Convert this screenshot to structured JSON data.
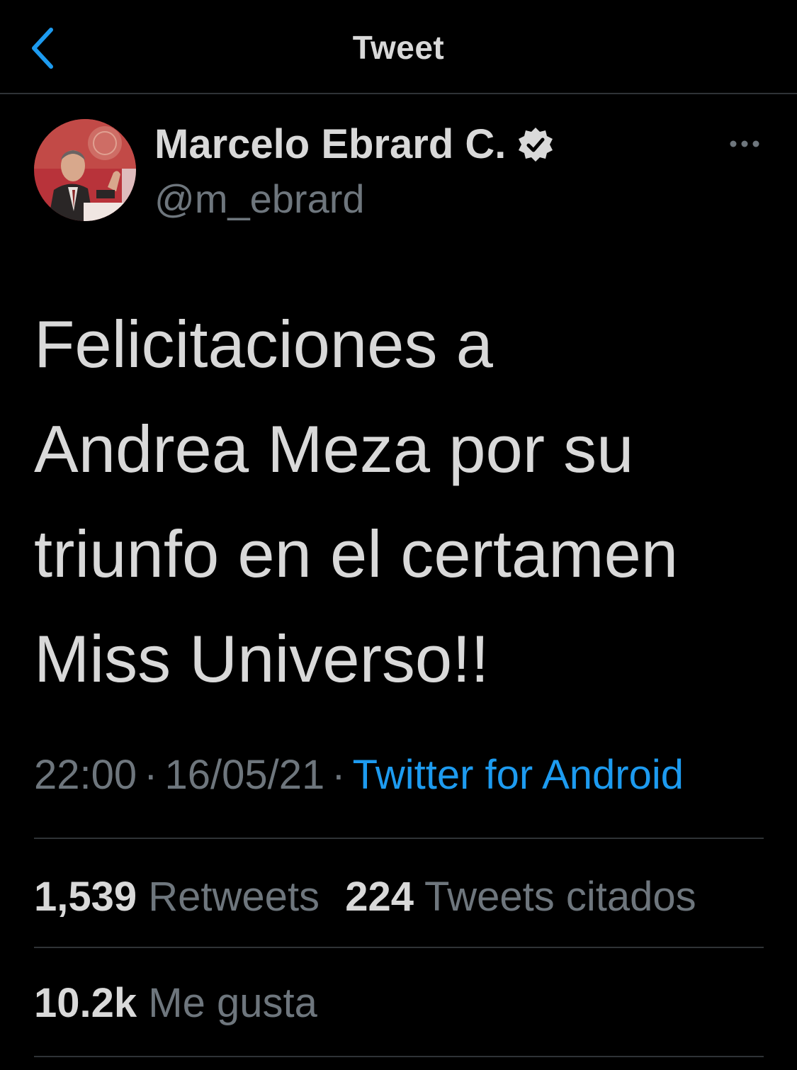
{
  "header": {
    "back_icon": "chevron-left-icon",
    "title": "Tweet"
  },
  "author": {
    "name": "Marcelo Ebrard C.",
    "handle": "@m_ebrard",
    "verified_icon": "verified-badge-icon",
    "more_icon": "more-horizontal-icon"
  },
  "tweet": {
    "text_lines": [
      "Felicitaciones a",
      "Andrea Meza por su",
      "triunfo en el certamen",
      "Miss Universo!!"
    ],
    "time": "22:00",
    "separator": "·",
    "date": "16/05/21",
    "source": "Twitter for Android"
  },
  "stats": {
    "retweets_count": "1,539",
    "retweets_label": "Retweets",
    "quotes_count": "224",
    "quotes_label": "Tweets citados",
    "likes_count": "10.2k",
    "likes_label": "Me gusta"
  },
  "colors": {
    "background": "#000000",
    "text": "#d9d9d9",
    "secondary": "#6e767d",
    "accent": "#1d9bf0",
    "divider": "#2f3336"
  }
}
